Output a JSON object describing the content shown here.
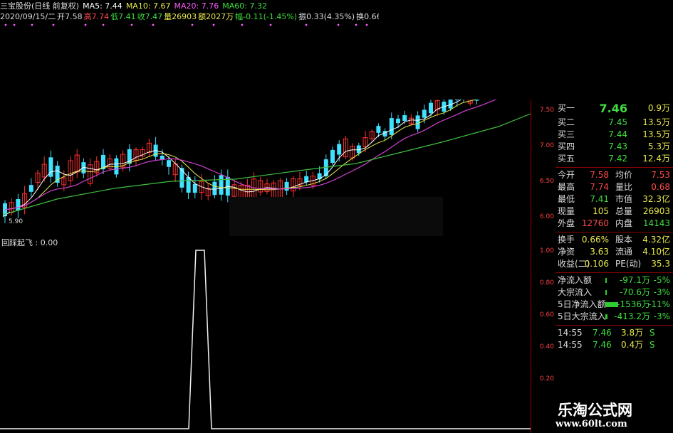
{
  "header": {
    "line1": [
      {
        "text": "三宝股份(日线 前复权)",
        "color": "#dddddd"
      },
      {
        "text": "MA5: 7.44",
        "color": "#ffffff"
      },
      {
        "text": "MA10: 7.67",
        "color": "#e8e84a"
      },
      {
        "text": "MA20: 7.76",
        "color": "#ff5cff"
      },
      {
        "text": "MA60: 7.32",
        "color": "#3fdd3f"
      }
    ],
    "line2": [
      {
        "text": "2020/09/15/二",
        "color": "#dddddd"
      },
      {
        "text": "开7.58",
        "color": "#dddddd"
      },
      {
        "text": "高7.74",
        "color": "#ff4a4a"
      },
      {
        "text": "低7.41",
        "color": "#3fdd3f"
      },
      {
        "text": "收7.47",
        "color": "#3fdd3f"
      },
      {
        "text": "量26903",
        "color": "#e8e84a"
      },
      {
        "text": "额2027万",
        "color": "#e8e84a"
      },
      {
        "text": "幅-0.11(-1.45%)",
        "color": "#3fdd3f"
      },
      {
        "text": "振0.33(4.35%)",
        "color": "#dddddd"
      },
      {
        "text": "换0.66%",
        "color": "#dddddd"
      },
      {
        "text": "流通4.10亿",
        "color": "#dddddd"
      },
      {
        "text": "其他建材",
        "color": "#e8e84a"
      }
    ]
  },
  "price_axis": [
    "7.50",
    "7.00",
    "6.50",
    "6.00"
  ],
  "low_marker": "5.90",
  "indicator": {
    "label": "回踩起飞 : 0.00"
  },
  "ind_axis": [
    "1.00",
    "0.80",
    "0.60",
    "0.40",
    "0.20"
  ],
  "order_book": [
    {
      "label": "买一",
      "price": "7.46",
      "vol": "0.9万"
    },
    {
      "label": "买二",
      "price": "7.45",
      "vol": "13.5万"
    },
    {
      "label": "买三",
      "price": "7.44",
      "vol": "13.5万"
    },
    {
      "label": "买四",
      "price": "7.43",
      "vol": "5.3万"
    },
    {
      "label": "买五",
      "price": "7.42",
      "vol": "12.4万"
    }
  ],
  "quote": [
    {
      "l1": "今开",
      "v1": "7.58",
      "c1": "#ff4a4a",
      "l2": "均价",
      "v2": "7.53",
      "c2": "#ff4a4a"
    },
    {
      "l1": "最高",
      "v1": "7.74",
      "c1": "#ff4a4a",
      "l2": "量比",
      "v2": "0.68",
      "c2": "#ff4a4a"
    },
    {
      "l1": "最低",
      "v1": "7.41",
      "c1": "#3fdd3f",
      "l2": "市值",
      "v2": "32.3亿",
      "c2": "#e8e84a"
    },
    {
      "l1": "现量",
      "v1": "105",
      "c1": "#e8e84a",
      "l2": "总量",
      "v2": "26903",
      "c2": "#e8e84a"
    },
    {
      "l1": "外盘",
      "v1": "12760",
      "c1": "#ff4a4a",
      "l2": "内盘",
      "v2": "14143",
      "c2": "#3fdd3f"
    }
  ],
  "stats": [
    {
      "l1": "换手",
      "v1": "0.66%",
      "l2": "股本",
      "v2": "4.32亿"
    },
    {
      "l1": "净资",
      "v1": "3.63",
      "l2": "流通",
      "v2": "4.10亿"
    },
    {
      "l1": "收益(二)",
      "v1": "0.106",
      "l2": "PE(动)",
      "v2": "35.3"
    }
  ],
  "flows": [
    {
      "label": "净流入额",
      "value": "-97.1万",
      "pct": "-5%",
      "bar": 0.02
    },
    {
      "label": "大宗流入",
      "value": "-70.6万",
      "pct": "-3%",
      "bar": 0.02
    },
    {
      "label": "5日净流入额",
      "value": "-1536万",
      "pct": "-11%",
      "bar": 0.6
    },
    {
      "label": "5日大宗流入",
      "value": "-413.2万",
      "pct": "-3%",
      "bar": 0.1
    }
  ],
  "ticks": [
    {
      "time": "14:55",
      "price": "7.46",
      "vol": "3.8万",
      "side": "S"
    },
    {
      "time": "14:55",
      "price": "7.46",
      "vol": "0.4万",
      "side": "S"
    }
  ],
  "logo": {
    "line1": "乐淘公式网",
    "line2": "www.60lt.com"
  },
  "colors": {
    "up": "#ff3030",
    "down": "#40e0ff",
    "ma5": "#ffffff",
    "ma10": "#e8e84a",
    "ma20": "#d040d0",
    "ma60": "#3fbf3f"
  }
}
